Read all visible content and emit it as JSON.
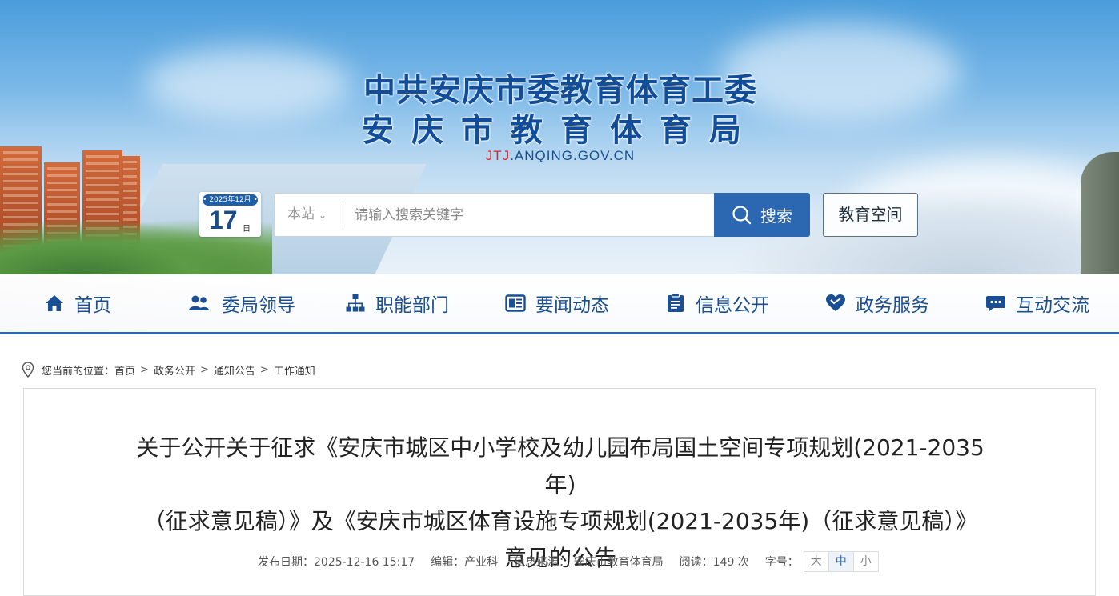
{
  "header": {
    "title_line1": "中共安庆市委教育体育工委",
    "title_line2": "安庆市教育体育局",
    "domain_red": "JTJ",
    "domain_rest": ".ANQING.GOV.CN",
    "date": {
      "year_month": "• 2025年12月 •",
      "day": "17",
      "day_unit": "日"
    }
  },
  "search": {
    "scope": "本站",
    "placeholder": "请输入搜索关键字",
    "button_label": "搜索",
    "edu_space_label": "教育空间"
  },
  "nav": {
    "items": [
      {
        "label": "首页",
        "icon": "home-icon"
      },
      {
        "label": "委局领导",
        "icon": "users-icon"
      },
      {
        "label": "职能部门",
        "icon": "org-chart-icon"
      },
      {
        "label": "要闻动态",
        "icon": "newspaper-icon"
      },
      {
        "label": "信息公开",
        "icon": "document-icon"
      },
      {
        "label": "政务服务",
        "icon": "heart-icon"
      },
      {
        "label": "互动交流",
        "icon": "chat-icon"
      }
    ]
  },
  "breadcrumb": {
    "prefix": "您当前的位置：",
    "items": [
      "首页",
      "政务公开",
      "通知公告",
      "工作通知"
    ],
    "separator": ">"
  },
  "article": {
    "title_line1": "关于公开关于征求《安庆市城区中小学校及幼儿园布局国土空间专项规划(2021-2035年)",
    "title_line2": "（征求意见稿）》及《安庆市城区体育设施专项规划(2021-2035年)（征求意见稿）》",
    "title_line3": "意见的公告",
    "meta": {
      "publish_date": "发布日期：2025-12-16 15:17",
      "editor": "编辑：产业科",
      "source": "信息来源： 安庆市教育体育局",
      "reads": "阅读：149 次",
      "font_size_label": "字号：",
      "font_sizes": [
        "大",
        "中",
        "小"
      ],
      "selected_font_size": "中"
    }
  },
  "colors": {
    "primary": "#2b68b1",
    "nav_text": "#1b4f94",
    "title": "#114d98",
    "domain_red": "#e0242a"
  }
}
